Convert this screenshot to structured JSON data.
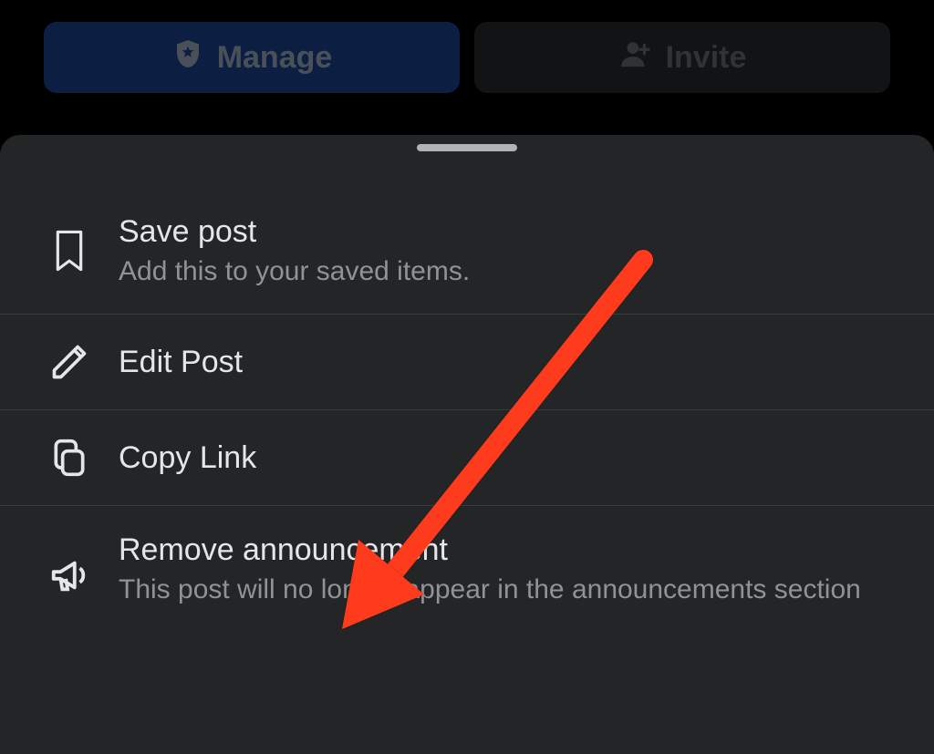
{
  "topButtons": {
    "manage": {
      "label": "Manage"
    },
    "invite": {
      "label": "Invite"
    }
  },
  "menu": {
    "savePost": {
      "title": "Save post",
      "subtitle": "Add this to your saved items."
    },
    "editPost": {
      "title": "Edit Post"
    },
    "copyLink": {
      "title": "Copy Link"
    },
    "removeAnnouncement": {
      "title": "Remove announcement",
      "subtitle": "This post will no longer appear in the announcements section"
    }
  }
}
